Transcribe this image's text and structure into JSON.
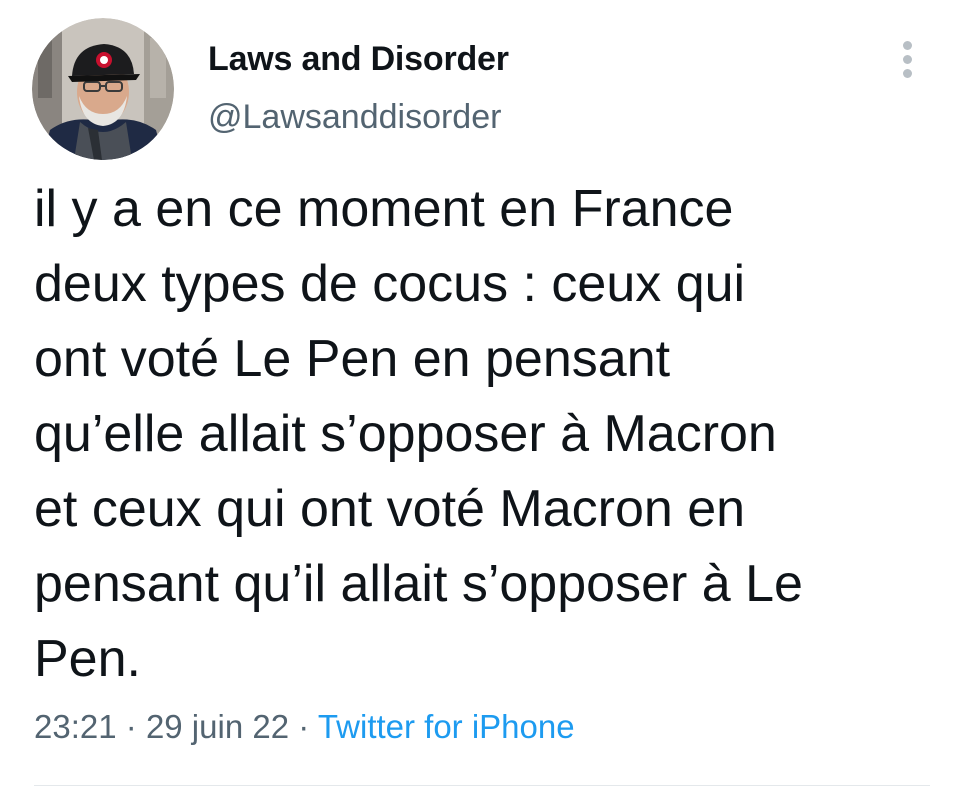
{
  "author": {
    "display_name": "Laws and Disorder",
    "handle": "@Lawsanddisorder",
    "avatar_icon": "profile-photo"
  },
  "tweet": {
    "lines": [
      "il y a en ce moment en France",
      "deux types de cocus : ceux qui",
      "ont voté Le Pen en pensant",
      "qu’elle allait s’opposer à Macron",
      "et ceux qui ont voté Macron en",
      "pensant qu’il allait s’opposer à Le",
      "Pen."
    ]
  },
  "meta": {
    "time": "23:21",
    "separator": "·",
    "date": "29 juin 22",
    "source": "Twitter for iPhone"
  },
  "menu_icon": "more-vertical-icon",
  "colors": {
    "text": "#0f1419",
    "secondary": "#536471",
    "link": "#1d9bf0",
    "divider": "#e4e8eb"
  }
}
